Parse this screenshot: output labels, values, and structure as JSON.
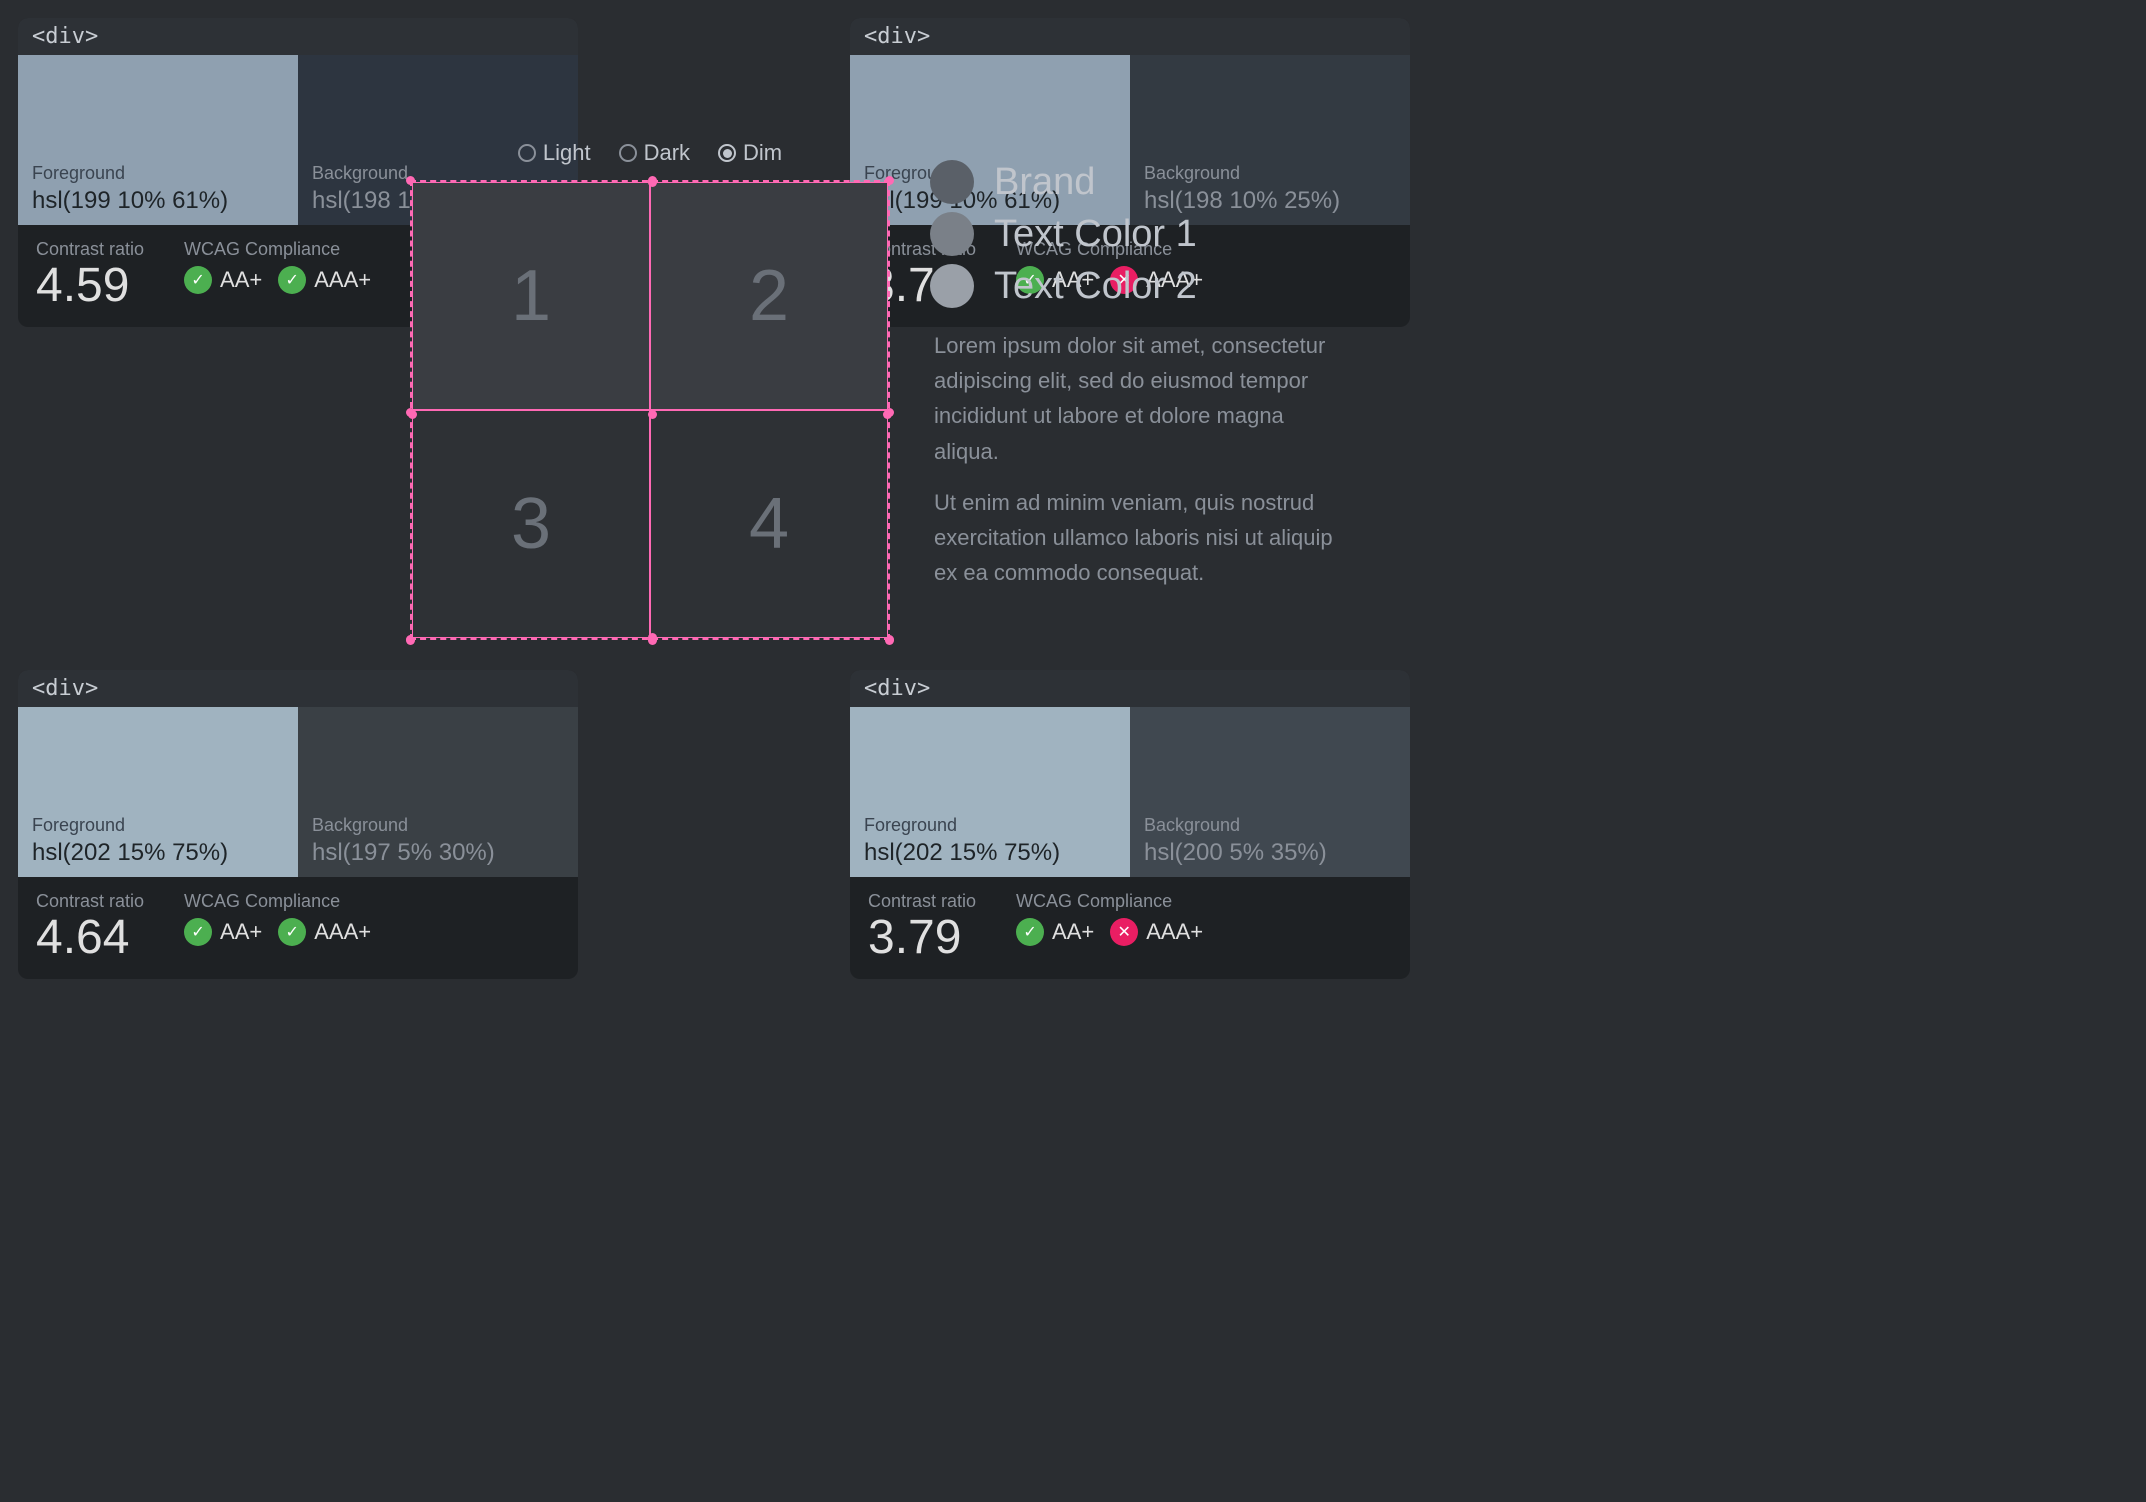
{
  "cards": {
    "top_left": {
      "title": "<div>",
      "foreground": {
        "label": "Foreground",
        "value": "hsl(199 10% 61%)"
      },
      "background": {
        "label": "Background",
        "value": "hsl(198 10% 20%)"
      },
      "contrast_label": "Contrast ratio",
      "contrast_value": "4.59",
      "wcag_label": "WCAG Compliance",
      "aa_label": "AA+",
      "aaa_label": "AAA+",
      "aa_pass": true,
      "aaa_pass": true
    },
    "top_right": {
      "title": "<div>",
      "foreground": {
        "label": "Foreground",
        "value": "hsl(199 10% 61%)"
      },
      "background": {
        "label": "Background",
        "value": "hsl(198 10% 25%)"
      },
      "contrast_label": "Contrast ratio",
      "contrast_value": "3.78",
      "wcag_label": "WCAG Compliance",
      "aa_label": "AA+",
      "aaa_label": "AAA+",
      "aa_pass": true,
      "aaa_pass": false
    },
    "bottom_left": {
      "title": "<div>",
      "foreground": {
        "label": "Foreground",
        "value": "hsl(202 15% 75%)"
      },
      "background": {
        "label": "Background",
        "value": "hsl(197 5% 30%)"
      },
      "contrast_label": "Contrast ratio",
      "contrast_value": "4.64",
      "wcag_label": "WCAG Compliance",
      "aa_label": "AA+",
      "aaa_label": "AAA+",
      "aa_pass": true,
      "aaa_pass": true
    },
    "bottom_right": {
      "title": "<div>",
      "foreground": {
        "label": "Foreground",
        "value": "hsl(202 15% 75%)"
      },
      "background": {
        "label": "Background",
        "value": "hsl(200 5% 35%)"
      },
      "contrast_label": "Contrast ratio",
      "contrast_value": "3.79",
      "wcag_label": "WCAG Compliance",
      "aa_label": "AA+",
      "aaa_label": "AAA+",
      "aa_pass": true,
      "aaa_pass": false
    }
  },
  "theme_selector": {
    "options": [
      "Light",
      "Dark",
      "Dim"
    ],
    "selected": "Dim"
  },
  "grid": {
    "cells": [
      "1",
      "2",
      "3",
      "4"
    ]
  },
  "legend": {
    "items": [
      {
        "label": "Brand"
      },
      {
        "label": "Text Color 1"
      },
      {
        "label": "Text Color 2"
      }
    ]
  },
  "body_text": [
    "Lorem ipsum dolor sit amet, consectetur adipiscing elit, sed do eiusmod tempor incididunt ut labore et dolore magna aliqua.",
    "Ut enim ad minim veniam, quis nostrud exercitation ullamco laboris nisi ut aliquip ex ea commodo consequat."
  ]
}
